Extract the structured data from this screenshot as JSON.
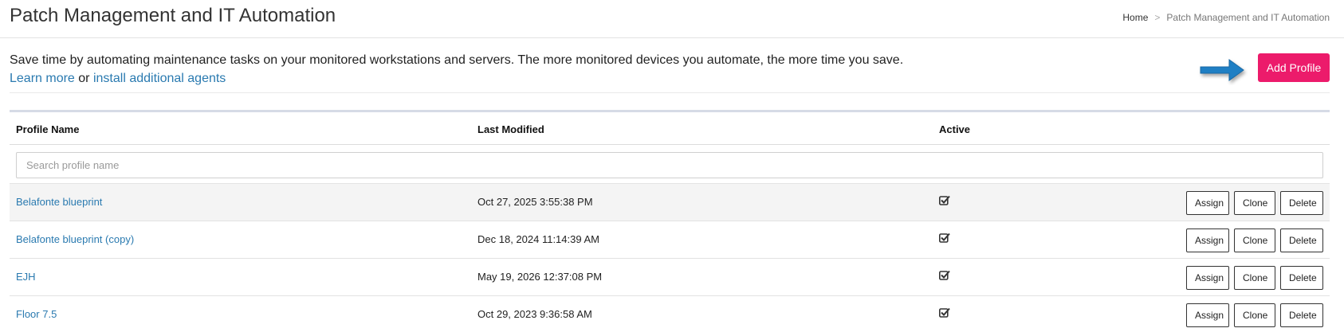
{
  "header": {
    "title": "Patch Management and IT Automation",
    "breadcrumb": {
      "home": "Home",
      "separator": ">",
      "current": "Patch Management and IT Automation"
    }
  },
  "intro": {
    "text": "Save time by automating maintenance tasks on your monitored workstations and servers. The more monitored devices you automate, the more time you save.",
    "learn_more": "Learn more",
    "or": "or",
    "install_agents": "install additional agents"
  },
  "actions": {
    "add_profile": "Add Profile"
  },
  "colors": {
    "accent": "#ec1b6b",
    "link": "#2a7ab0",
    "arrow": "#1f7fc4"
  },
  "table": {
    "columns": {
      "name": "Profile Name",
      "modified": "Last Modified",
      "active": "Active"
    },
    "search": {
      "placeholder": "Search profile name",
      "value": ""
    },
    "row_buttons": {
      "assign": "Assign",
      "clone": "Clone",
      "delete": "Delete"
    },
    "rows": [
      {
        "name": "Belafonte blueprint",
        "modified": "Oct 27, 2025 3:55:38 PM",
        "active": true
      },
      {
        "name": "Belafonte blueprint (copy)",
        "modified": "Dec 18, 2024 11:14:39 AM",
        "active": true
      },
      {
        "name": "EJH",
        "modified": "May 19, 2026 12:37:08 PM",
        "active": true
      },
      {
        "name": "Floor 7.5",
        "modified": "Oct 29, 2023 9:36:58 AM",
        "active": true
      }
    ]
  }
}
